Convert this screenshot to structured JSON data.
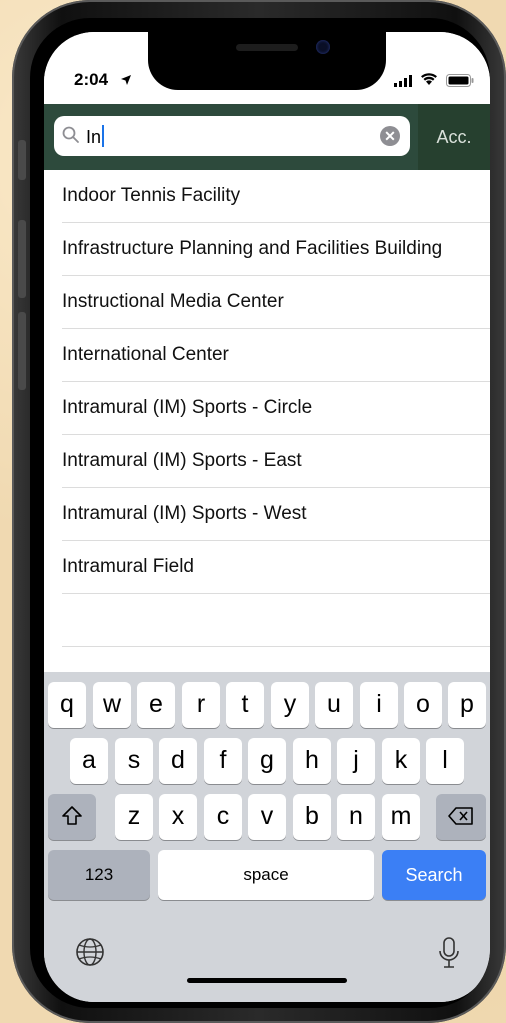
{
  "status_bar": {
    "time": "2:04"
  },
  "search": {
    "value": "In",
    "accessory_label": "Acc."
  },
  "results": [
    "Indoor Tennis Facility",
    "Infrastructure Planning and Facilities Building",
    "Instructional Media Center",
    "International Center",
    "Intramural (IM) Sports - Circle",
    "Intramural (IM) Sports - East",
    "Intramural (IM) Sports - West",
    "Intramural Field"
  ],
  "keyboard": {
    "row1": [
      "q",
      "w",
      "e",
      "r",
      "t",
      "y",
      "u",
      "i",
      "o",
      "p"
    ],
    "row2": [
      "a",
      "s",
      "d",
      "f",
      "g",
      "h",
      "j",
      "k",
      "l"
    ],
    "row3": [
      "z",
      "x",
      "c",
      "v",
      "b",
      "n",
      "m"
    ],
    "numbers_key": "123",
    "space_key": "space",
    "search_key": "Search"
  },
  "colors": {
    "search_bar_bg": "#2d4a3c",
    "accent_blue": "#3b7ff5"
  }
}
